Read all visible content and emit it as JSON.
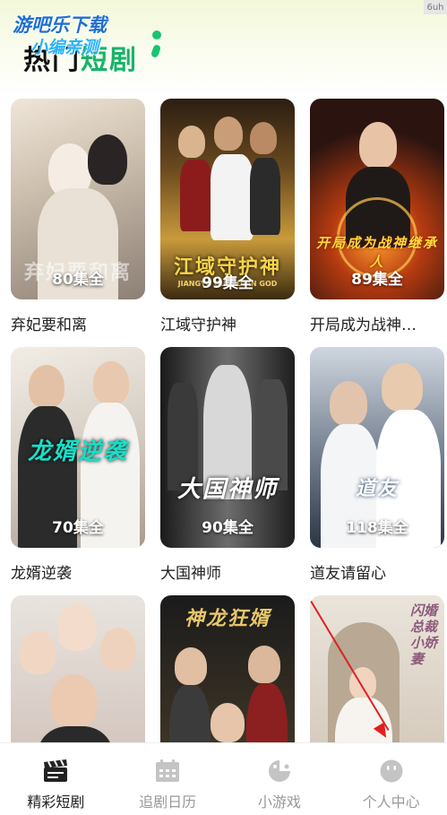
{
  "header": {
    "section_title_a": "热门",
    "section_title_b": "短剧",
    "watermark_line1": "游吧乐下载",
    "watermark_line2": "小编亲测",
    "corner_tag": "6uh"
  },
  "dramas": [
    {
      "name": "弃妃要和离",
      "episodes": "80集全",
      "poster_text": "弃妃要和离",
      "icon": "poster-image"
    },
    {
      "name": "江域守护神",
      "episodes": "99集全",
      "poster_text": "江域守护神",
      "poster_sub": "JIANGYU GUARDIAN GOD",
      "icon": "poster-image"
    },
    {
      "name": "开局成为战神…",
      "episodes": "89集全",
      "poster_text": "开局成为战神继承人",
      "icon": "poster-image"
    },
    {
      "name": "龙婿逆袭",
      "episodes": "70集全",
      "poster_text": "龙婿逆袭",
      "icon": "poster-image"
    },
    {
      "name": "大国神师",
      "episodes": "90集全",
      "poster_text": "大国神师",
      "icon": "poster-image"
    },
    {
      "name": "道友请留心",
      "episodes": "118集全",
      "poster_text": "道友",
      "icon": "poster-image"
    },
    {
      "name": "",
      "episodes": "",
      "poster_text": "",
      "icon": "poster-image"
    },
    {
      "name": "",
      "episodes": "",
      "poster_text": "神龙狂婿",
      "icon": "poster-image"
    },
    {
      "name": "",
      "episodes": "",
      "poster_text": "闪婚总裁小娇妻",
      "icon": "poster-image"
    }
  ],
  "tabs": [
    {
      "label": "精彩短剧",
      "icon": "clapperboard-icon",
      "active": true
    },
    {
      "label": "追剧日历",
      "icon": "calendar-icon",
      "active": false
    },
    {
      "label": "小游戏",
      "icon": "gamepad-icon",
      "active": false
    },
    {
      "label": "个人中心",
      "icon": "smiley-user-icon",
      "active": false
    }
  ],
  "colors": {
    "accent": "#18b36a",
    "annotation_arrow": "#e02020",
    "tab_active": "#222222",
    "tab_inactive": "#999999"
  }
}
